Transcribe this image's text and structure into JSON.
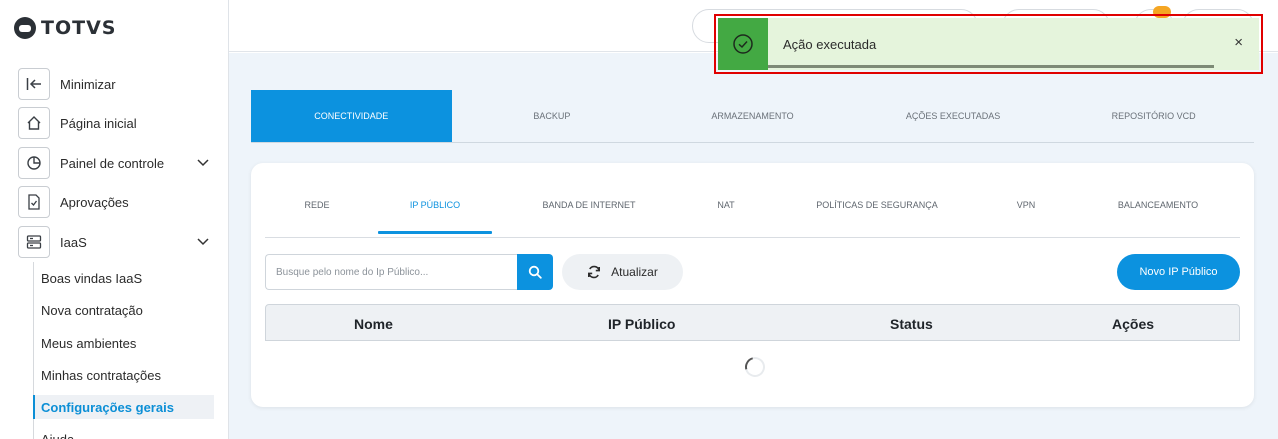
{
  "brand": {
    "name": "TOTVS"
  },
  "sidebar": {
    "items": [
      {
        "label": "Minimizar",
        "icon": "collapse-left-icon"
      },
      {
        "label": "Página inicial",
        "icon": "home-icon"
      },
      {
        "label": "Painel de controle",
        "icon": "pie-chart-icon"
      },
      {
        "label": "Aprovações",
        "icon": "document-check-icon"
      },
      {
        "label": "IaaS",
        "icon": "server-icon"
      }
    ],
    "subitems": [
      {
        "label": "Boas vindas IaaS"
      },
      {
        "label": "Nova contratação"
      },
      {
        "label": "Meus ambientes"
      },
      {
        "label": "Minhas contratações"
      },
      {
        "label": "Configurações gerais"
      },
      {
        "label": "Ajuda"
      }
    ],
    "active_subitem": "Configurações gerais"
  },
  "main_tabs": [
    {
      "label": "CONECTIVIDADE"
    },
    {
      "label": "BACKUP"
    },
    {
      "label": "ARMAZENAMENTO"
    },
    {
      "label": "AÇÕES EXECUTADAS"
    },
    {
      "label": "REPOSITÓRIO VCD"
    }
  ],
  "active_main_tab": "CONECTIVIDADE",
  "sub_tabs": [
    {
      "label": "REDE"
    },
    {
      "label": "IP PÚBLICO"
    },
    {
      "label": "BANDA DE INTERNET"
    },
    {
      "label": "NAT"
    },
    {
      "label": "POLÍTICAS DE SEGURANÇA"
    },
    {
      "label": "VPN"
    },
    {
      "label": "BALANCEAMENTO"
    }
  ],
  "active_sub_tab": "IP PÚBLICO",
  "search": {
    "placeholder": "Busque pelo nome do Ip Público..."
  },
  "buttons": {
    "refresh": "Atualizar",
    "new_ip": "Novo IP Público"
  },
  "table": {
    "columns": [
      "Nome",
      "IP Público",
      "Status",
      "Ações"
    ]
  },
  "toast": {
    "message": "Ação executada",
    "close": "×"
  },
  "colors": {
    "accent": "#0c92df",
    "success": "#43a943",
    "toast_bg": "#e5f4dc",
    "highlight": "#e00000"
  }
}
